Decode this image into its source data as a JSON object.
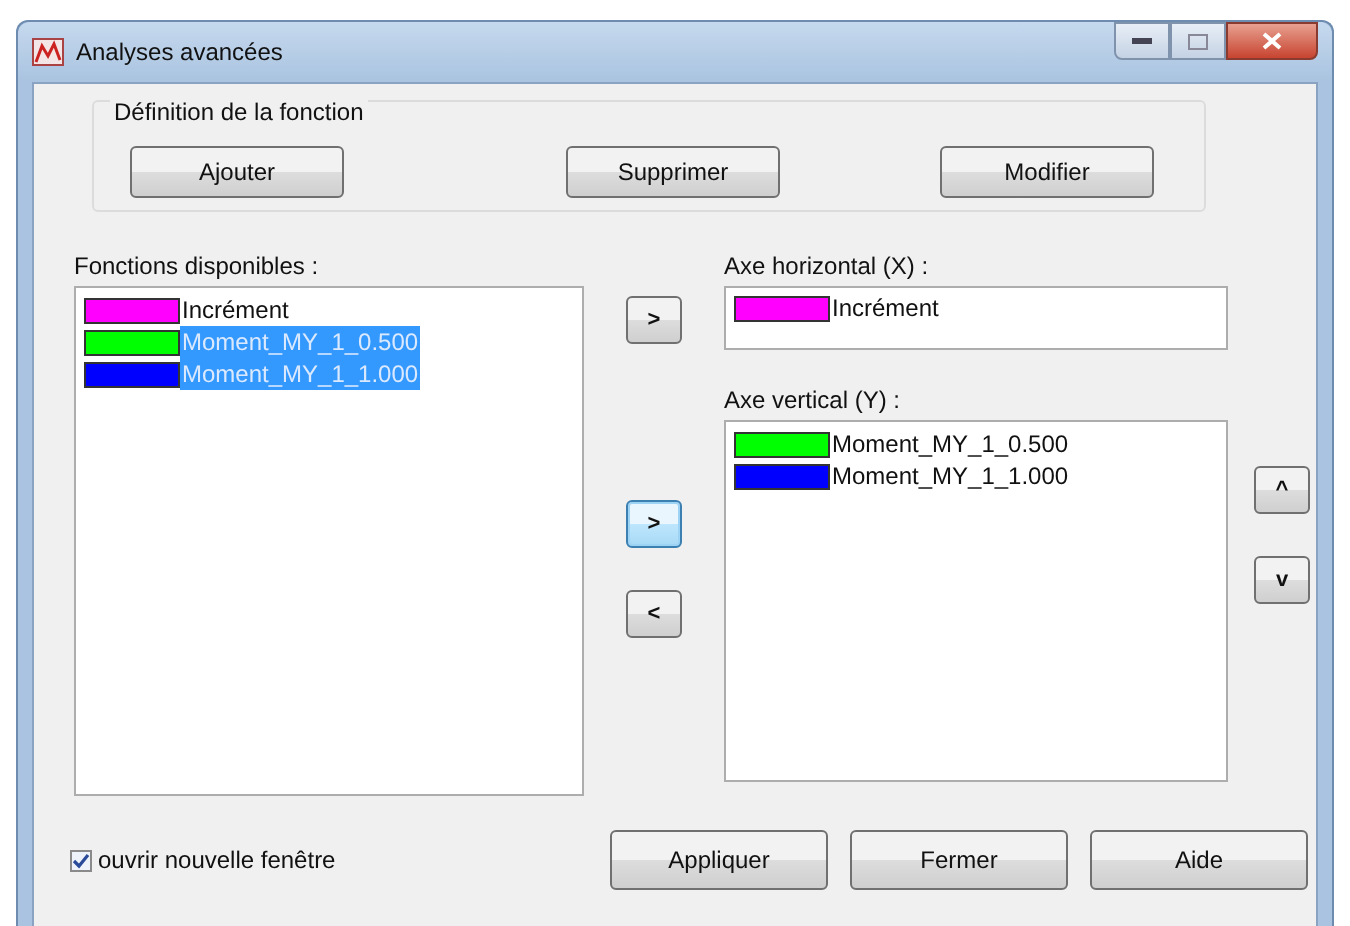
{
  "window": {
    "title": "Analyses avancées"
  },
  "definition_group": {
    "title": "Définition de la fonction",
    "buttons": [
      "Ajouter",
      "Supprimer",
      "Modifier"
    ]
  },
  "available": {
    "label": "Fonctions disponibles :",
    "items": [
      {
        "name": "Incrément",
        "color": "#ff00ff",
        "selected": false
      },
      {
        "name": "Moment_MY_1_0.500",
        "color": "#00ff00",
        "selected": true
      },
      {
        "name": "Moment_MY_1_1.000",
        "color": "#0000ff",
        "selected": true
      }
    ]
  },
  "move_buttons": [
    {
      "label": ">",
      "focused": false
    },
    {
      "label": ">",
      "focused": true
    },
    {
      "label": "<",
      "focused": false
    }
  ],
  "horizontal_axis": {
    "label": "Axe horizontal (X) :",
    "item": {
      "name": "Incrément",
      "color": "#ff00ff"
    }
  },
  "vertical_axis": {
    "label": "Axe vertical (Y) :",
    "items": [
      {
        "name": "Moment_MY_1_0.500",
        "color": "#00ff00"
      },
      {
        "name": "Moment_MY_1_1.000",
        "color": "#0000ff"
      }
    ]
  },
  "order_buttons": [
    "^",
    "v"
  ],
  "open_new_window": {
    "label": "ouvrir nouvelle fenêtre",
    "checked": true
  },
  "buttons": [
    "Appliquer",
    "Fermer",
    "Aide"
  ]
}
